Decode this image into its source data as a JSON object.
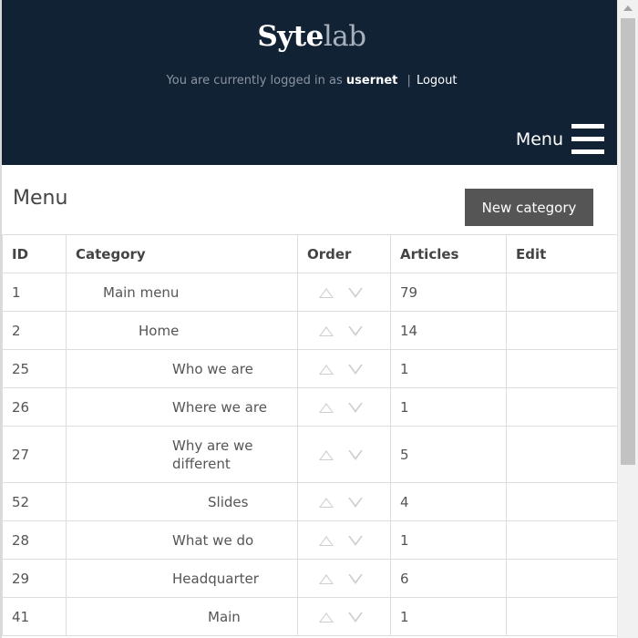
{
  "header": {
    "brand_bold": "Syte",
    "brand_light": "lab",
    "login_prefix": "You are currently logged in as",
    "username": "usernet",
    "separator": "|",
    "logout_label": "Logout",
    "menu_label": "Menu",
    "menu_icon": "hamburger-icon",
    "background_color": "#122235"
  },
  "page": {
    "title": "Menu",
    "new_category_label": "New category"
  },
  "table": {
    "columns": [
      "ID",
      "Category",
      "Order",
      "Articles",
      "Edit"
    ],
    "rows": [
      {
        "id": "1",
        "category": "Main menu",
        "level": 1,
        "articles": "79"
      },
      {
        "id": "2",
        "category": "Home",
        "level": 2,
        "articles": "14"
      },
      {
        "id": "25",
        "category": "Who we are",
        "level": 3,
        "articles": "1"
      },
      {
        "id": "26",
        "category": "Where we are",
        "level": 3,
        "articles": "1"
      },
      {
        "id": "27",
        "category": "Why are we different",
        "level": 3,
        "articles": "5"
      },
      {
        "id": "52",
        "category": "Slides",
        "level": 4,
        "articles": "4"
      },
      {
        "id": "28",
        "category": "What we do",
        "level": 3,
        "articles": "1"
      },
      {
        "id": "29",
        "category": "Headquarter",
        "level": 3,
        "articles": "6"
      },
      {
        "id": "41",
        "category": "Main",
        "level": 4,
        "articles": "1"
      }
    ],
    "order_up_icon": "triangle-up-icon",
    "order_down_icon": "triangle-down-icon"
  }
}
